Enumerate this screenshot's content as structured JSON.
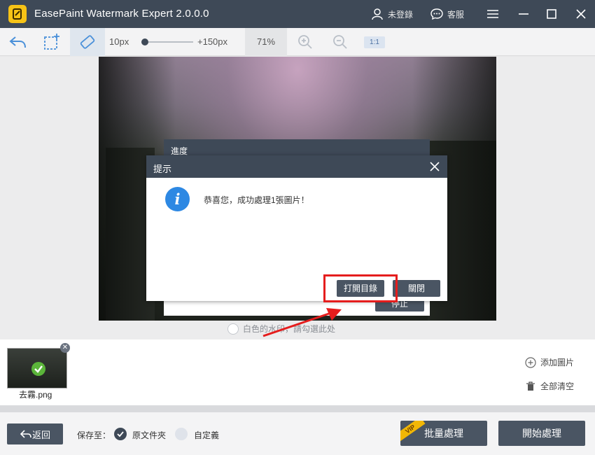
{
  "app": {
    "title": "EasePaint Watermark Expert  2.0.0.0",
    "user_label": "未登錄",
    "service_label": "客服"
  },
  "toolbar": {
    "brush_min": "10px",
    "brush_max": "+150px",
    "zoom": "71%",
    "ratio": "1:1",
    "brush_level": 0
  },
  "canvas": {
    "watermark_option": "白色的水印，請勾選此处"
  },
  "progress_dialog": {
    "title": "進度",
    "stop_label": "停止"
  },
  "dialog": {
    "title": "提示",
    "message": "恭喜您，成功處理1張圖片！",
    "open_folder_label": "打開目錄",
    "close_label": "關閉"
  },
  "files": {
    "items": [
      {
        "name": "去霧.png",
        "status": "done"
      }
    ],
    "add_label": "添加圖片",
    "clear_label": "全部清空"
  },
  "bottom": {
    "back_label": "返回",
    "save_to_label": "保存至：",
    "original_folder_label": "原文件夾",
    "custom_label": "自定義",
    "batch_label": "批量處理",
    "vip_badge": "VIP",
    "start_label": "開始處理"
  },
  "colors": {
    "header": "#3e4957",
    "button": "#4a5563",
    "info": "#2d88e3",
    "highlight": "#e51d1d",
    "success": "#5bb53a",
    "vip": "#f2b705"
  }
}
